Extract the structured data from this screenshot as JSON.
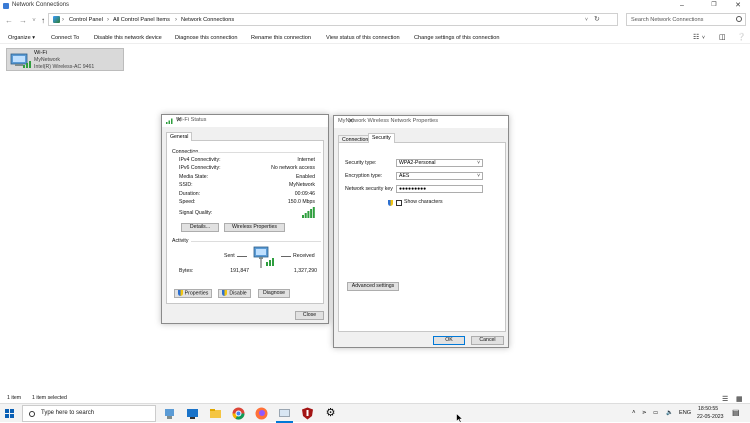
{
  "window": {
    "title": "Network Connections"
  },
  "address": {
    "crumbs": [
      "Control Panel",
      "All Control Panel Items",
      "Network Connections"
    ],
    "search_placeholder": "Search Network Connections"
  },
  "commands": [
    "Organize ▾",
    "Connect To",
    "Disable this network device",
    "Diagnose this connection",
    "Rename this connection",
    "View status of this connection",
    "Change settings of this connection"
  ],
  "adapter": {
    "name": "Wi-Fi",
    "network": "MyNetwork",
    "device": "Intel(R) Wireless-AC 9461"
  },
  "wifi_status": {
    "title": "Wi-Fi Status",
    "tab": "General",
    "connection_header": "Connection",
    "rows": [
      {
        "label": "IPv4 Connectivity:",
        "value": "Internet"
      },
      {
        "label": "IPv6 Connectivity:",
        "value": "No network access"
      },
      {
        "label": "Media State:",
        "value": "Enabled"
      },
      {
        "label": "SSID:",
        "value": "MyNetwork"
      },
      {
        "label": "Duration:",
        "value": "00:09:46"
      },
      {
        "label": "Speed:",
        "value": "150.0 Mbps"
      }
    ],
    "signal_label": "Signal Quality:",
    "details_btn": "Details...",
    "wireless_btn": "Wireless Properties",
    "activity_header": "Activity",
    "sent_label": "Sent",
    "received_label": "Received",
    "bytes_label": "Bytes:",
    "bytes_sent": "191,847",
    "bytes_received": "1,327,290",
    "properties_btn": "Properties",
    "disable_btn": "Disable",
    "diagnose_btn": "Diagnose",
    "close_btn": "Close"
  },
  "wireless_props": {
    "title": "MyNetwork Wireless Network Properties",
    "tabs": [
      "Connection",
      "Security"
    ],
    "security_type_label": "Security type:",
    "security_type_value": "WPA2-Personal",
    "encryption_label": "Encryption type:",
    "encryption_value": "AES",
    "key_label": "Network security key",
    "key_value": "●●●●●●●●●",
    "show_chars": "Show characters",
    "advanced_btn": "Advanced settings",
    "ok_btn": "OK",
    "cancel_btn": "Cancel"
  },
  "status_bar": {
    "items": "1 item",
    "selected": "1 item selected"
  },
  "taskbar": {
    "search": "Type here to search",
    "lang": "ENG",
    "time": "18:50:55",
    "date": "22-05-2023"
  }
}
